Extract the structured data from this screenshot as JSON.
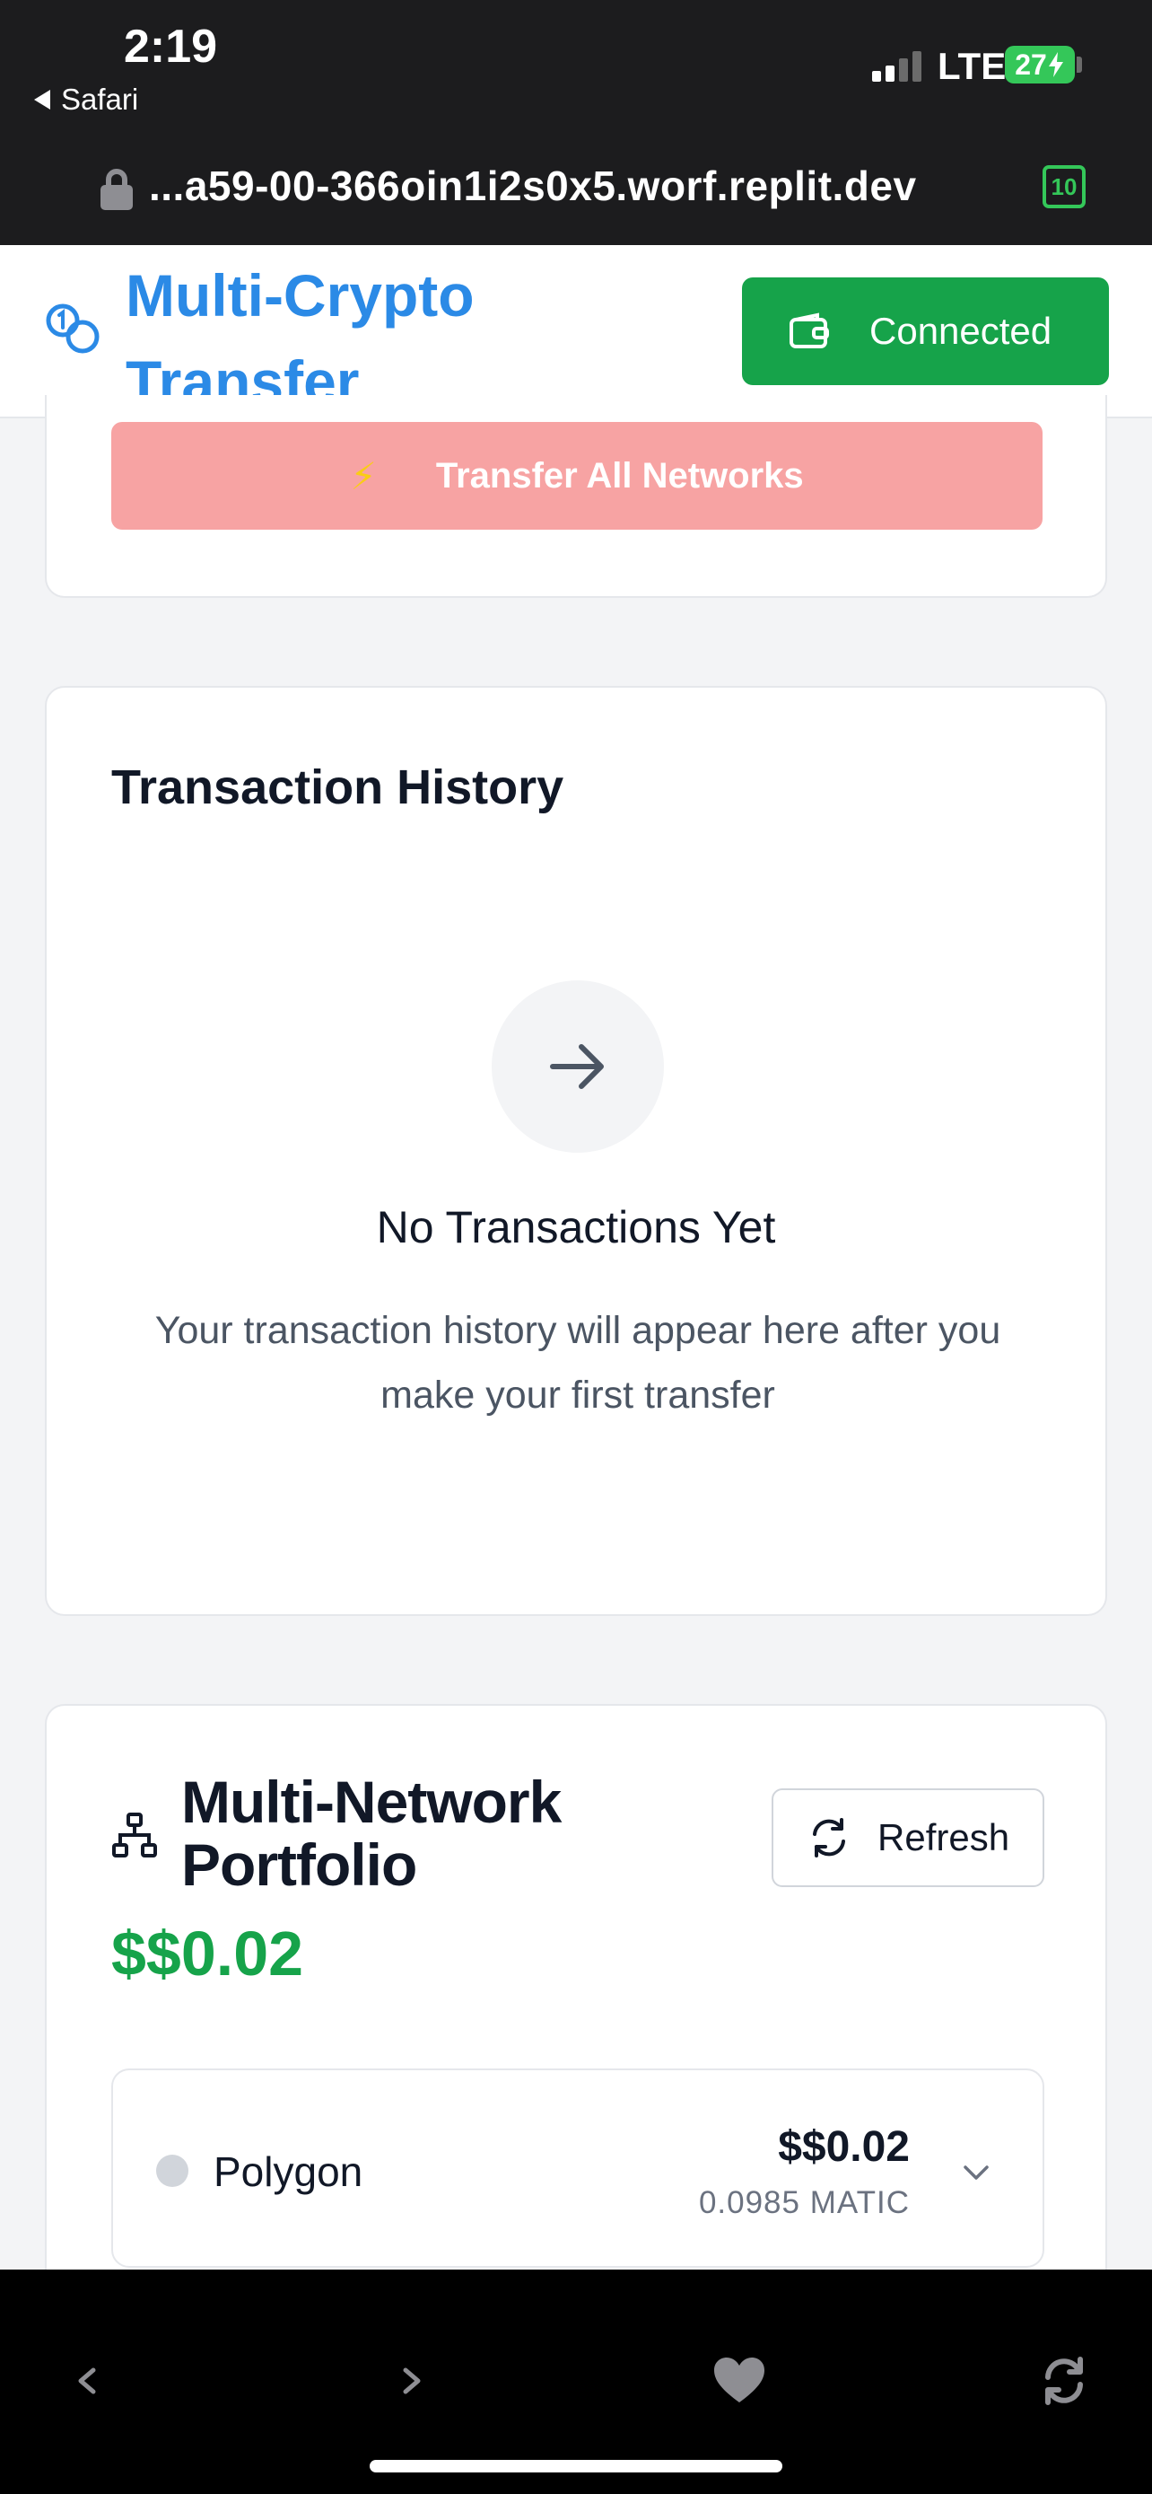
{
  "status_bar": {
    "time": "2:19",
    "back_app": "Safari",
    "network": "LTE",
    "battery": "27"
  },
  "browser": {
    "url": "...a59-00-366oin1i2s0x5.worf.replit.dev",
    "tab_count": "10"
  },
  "header": {
    "title": "Multi-Crypto Transfer",
    "connect_label": "Connected"
  },
  "transfer": {
    "button_label": "Transfer All Networks",
    "icon_glyph": "⚡"
  },
  "history": {
    "title": "Transaction History",
    "empty_title": "No Transactions Yet",
    "empty_description": "Your transaction history will appear here after you make your first transfer"
  },
  "portfolio": {
    "title": "Multi-Network Portfolio",
    "refresh_label": "Refresh",
    "total": "$$0.02",
    "networks": [
      {
        "name": "Polygon",
        "usd": "$$0.02",
        "amount": "0.0985 MATIC"
      }
    ]
  },
  "colors": {
    "accent_blue": "#2b8ae6",
    "success_green": "#16a34a",
    "disabled_red": "#f7a3a3"
  },
  "icons": [
    "coins-icon",
    "wallet-icon",
    "lightning-icon",
    "arrow-right-icon",
    "network-icon",
    "refresh-icon",
    "chevron-down-icon",
    "lock-icon",
    "back-icon",
    "forward-icon",
    "heart-icon",
    "reload-icon"
  ]
}
